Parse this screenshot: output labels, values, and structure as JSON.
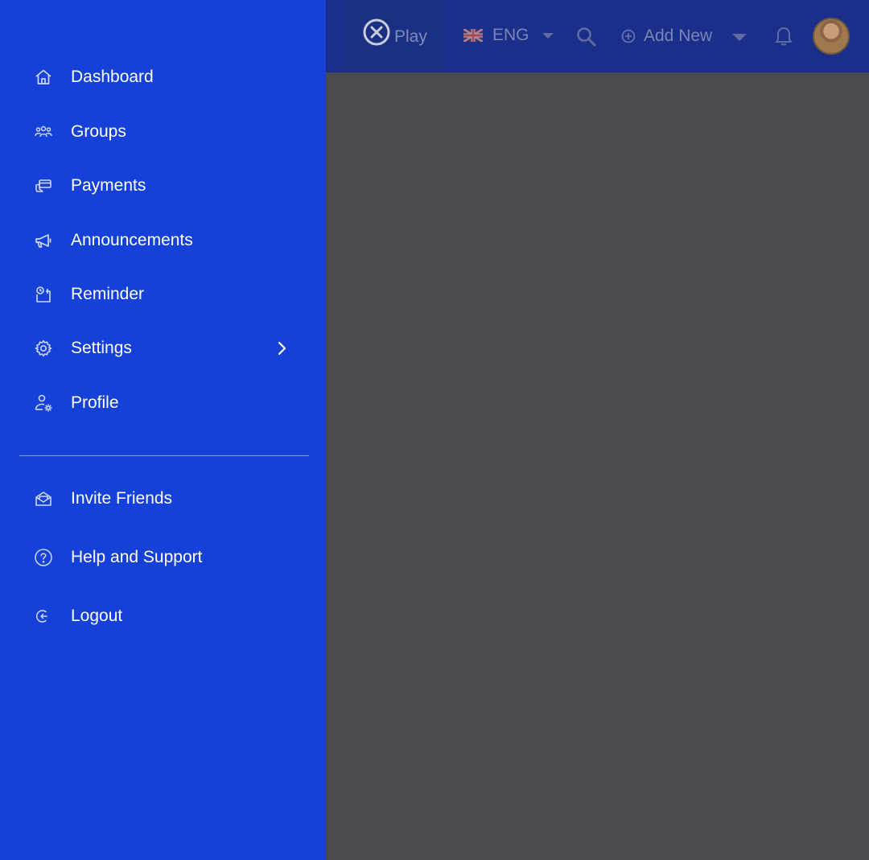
{
  "topbar": {
    "play_label": "Play",
    "language": "ENG",
    "add_new_label": "Add New"
  },
  "sidebar": {
    "items": [
      {
        "label": "Dashboard",
        "icon": "home-icon"
      },
      {
        "label": "Groups",
        "icon": "groups-icon"
      },
      {
        "label": "Payments",
        "icon": "payments-icon"
      },
      {
        "label": "Announcements",
        "icon": "megaphone-icon"
      },
      {
        "label": "Reminder",
        "icon": "reminder-icon"
      },
      {
        "label": "Settings",
        "icon": "gear-icon"
      },
      {
        "label": "Profile",
        "icon": "profile-settings-icon"
      }
    ],
    "secondary": [
      {
        "label": "Invite Friends",
        "icon": "envelope-open-icon"
      },
      {
        "label": "Help and Support",
        "icon": "help-circle-icon"
      },
      {
        "label": "Logout",
        "icon": "logout-icon"
      }
    ]
  },
  "colors": {
    "drawer_bg": "#1641d8",
    "topbar_bg": "#1a2e8a",
    "overlay": "#4a494f"
  }
}
